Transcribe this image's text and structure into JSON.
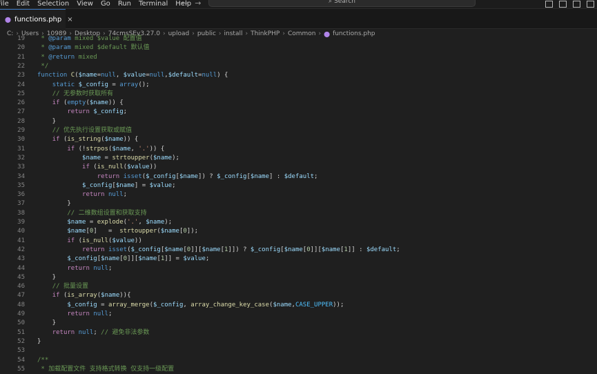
{
  "menu": [
    "File",
    "Edit",
    "Selection",
    "View",
    "Go",
    "Run",
    "Terminal",
    "Help"
  ],
  "search_placeholder": "Search",
  "tab": {
    "label": "functions.php",
    "close": "×"
  },
  "breadcrumb": [
    "C:",
    "Users",
    "10989",
    "Desktop",
    "74cmsSEv3.27.0",
    "upload",
    "public",
    "install",
    "ThinkPHP",
    "Common",
    "functions.php"
  ],
  "colors": {
    "keyword": "#569cd6",
    "control": "#c586c0",
    "function": "#dcdcaa",
    "variable": "#9cdcfe",
    "string": "#ce9178",
    "comment": "#6a9955"
  },
  "code_lines": [
    {
      "n": "19",
      "t": [
        [
          "cmt",
          " * "
        ],
        [
          "doc",
          "@param"
        ],
        [
          "cmt",
          " mixed $value 配置值"
        ]
      ]
    },
    {
      "n": "20",
      "t": [
        [
          "cmt",
          " * "
        ],
        [
          "doc",
          "@param"
        ],
        [
          "cmt",
          " mixed $default 默认值"
        ]
      ]
    },
    {
      "n": "21",
      "t": [
        [
          "cmt",
          " * "
        ],
        [
          "doc",
          "@return"
        ],
        [
          "cmt",
          " mixed"
        ]
      ]
    },
    {
      "n": "22",
      "t": [
        [
          "cmt",
          " */"
        ]
      ]
    },
    {
      "n": "23",
      "t": [
        [
          "kw",
          "function"
        ],
        [
          "pl",
          " "
        ],
        [
          "fn",
          "C"
        ],
        [
          "pl",
          "("
        ],
        [
          "var",
          "$name"
        ],
        [
          "pl",
          "="
        ],
        [
          "kw",
          "null"
        ],
        [
          "pl",
          ", "
        ],
        [
          "var",
          "$value"
        ],
        [
          "pl",
          "="
        ],
        [
          "kw",
          "null"
        ],
        [
          "pl",
          ","
        ],
        [
          "var",
          "$default"
        ],
        [
          "pl",
          "="
        ],
        [
          "kw",
          "null"
        ],
        [
          "pl",
          ") {"
        ]
      ]
    },
    {
      "n": "24",
      "t": [
        [
          "pl",
          "    "
        ],
        [
          "kw",
          "static"
        ],
        [
          "pl",
          " "
        ],
        [
          "var",
          "$_config"
        ],
        [
          "pl",
          " = "
        ],
        [
          "kw",
          "array"
        ],
        [
          "pl",
          "();"
        ]
      ]
    },
    {
      "n": "25",
      "t": [
        [
          "pl",
          "    "
        ],
        [
          "cmt",
          "// 无参数时获取所有"
        ]
      ]
    },
    {
      "n": "26",
      "t": [
        [
          "pl",
          "    "
        ],
        [
          "ctl",
          "if"
        ],
        [
          "pl",
          " ("
        ],
        [
          "kw",
          "empty"
        ],
        [
          "pl",
          "("
        ],
        [
          "var",
          "$name"
        ],
        [
          "pl",
          ")) {"
        ]
      ]
    },
    {
      "n": "27",
      "t": [
        [
          "pl",
          "        "
        ],
        [
          "ctl",
          "return"
        ],
        [
          "pl",
          " "
        ],
        [
          "var",
          "$_config"
        ],
        [
          "pl",
          ";"
        ]
      ]
    },
    {
      "n": "28",
      "t": [
        [
          "pl",
          "    }"
        ]
      ]
    },
    {
      "n": "29",
      "t": [
        [
          "pl",
          "    "
        ],
        [
          "cmt",
          "// 优先执行设置获取或赋值"
        ]
      ]
    },
    {
      "n": "30",
      "t": [
        [
          "pl",
          "    "
        ],
        [
          "ctl",
          "if"
        ],
        [
          "pl",
          " ("
        ],
        [
          "fn",
          "is_string"
        ],
        [
          "pl",
          "("
        ],
        [
          "var",
          "$name"
        ],
        [
          "pl",
          ")) {"
        ]
      ]
    },
    {
      "n": "31",
      "t": [
        [
          "pl",
          "        "
        ],
        [
          "ctl",
          "if"
        ],
        [
          "pl",
          " (!"
        ],
        [
          "fn",
          "strpos"
        ],
        [
          "pl",
          "("
        ],
        [
          "var",
          "$name"
        ],
        [
          "pl",
          ", "
        ],
        [
          "str",
          "'.'"
        ],
        [
          "pl",
          ")) {"
        ]
      ]
    },
    {
      "n": "32",
      "t": [
        [
          "pl",
          "            "
        ],
        [
          "var",
          "$name"
        ],
        [
          "pl",
          " = "
        ],
        [
          "fn",
          "strtoupper"
        ],
        [
          "pl",
          "("
        ],
        [
          "var",
          "$name"
        ],
        [
          "pl",
          ");"
        ]
      ]
    },
    {
      "n": "33",
      "t": [
        [
          "pl",
          "            "
        ],
        [
          "ctl",
          "if"
        ],
        [
          "pl",
          " ("
        ],
        [
          "fn",
          "is_null"
        ],
        [
          "pl",
          "("
        ],
        [
          "var",
          "$value"
        ],
        [
          "pl",
          "))"
        ]
      ]
    },
    {
      "n": "34",
      "t": [
        [
          "pl",
          "                "
        ],
        [
          "ctl",
          "return"
        ],
        [
          "pl",
          " "
        ],
        [
          "kw",
          "isset"
        ],
        [
          "pl",
          "("
        ],
        [
          "var",
          "$_config"
        ],
        [
          "pl",
          "["
        ],
        [
          "var",
          "$name"
        ],
        [
          "pl",
          "]) ? "
        ],
        [
          "var",
          "$_config"
        ],
        [
          "pl",
          "["
        ],
        [
          "var",
          "$name"
        ],
        [
          "pl",
          "] : "
        ],
        [
          "var",
          "$default"
        ],
        [
          "pl",
          ";"
        ]
      ]
    },
    {
      "n": "35",
      "t": [
        [
          "pl",
          "            "
        ],
        [
          "var",
          "$_config"
        ],
        [
          "pl",
          "["
        ],
        [
          "var",
          "$name"
        ],
        [
          "pl",
          "] = "
        ],
        [
          "var",
          "$value"
        ],
        [
          "pl",
          ";"
        ]
      ]
    },
    {
      "n": "36",
      "t": [
        [
          "pl",
          "            "
        ],
        [
          "ctl",
          "return"
        ],
        [
          "pl",
          " "
        ],
        [
          "kw",
          "null"
        ],
        [
          "pl",
          ";"
        ]
      ]
    },
    {
      "n": "37",
      "t": [
        [
          "pl",
          "        }"
        ]
      ]
    },
    {
      "n": "38",
      "t": [
        [
          "pl",
          "        "
        ],
        [
          "cmt",
          "// 二维数组设置和获取支持"
        ]
      ]
    },
    {
      "n": "39",
      "t": [
        [
          "pl",
          "        "
        ],
        [
          "var",
          "$name"
        ],
        [
          "pl",
          " = "
        ],
        [
          "fn",
          "explode"
        ],
        [
          "pl",
          "("
        ],
        [
          "str",
          "'.'"
        ],
        [
          "pl",
          ", "
        ],
        [
          "var",
          "$name"
        ],
        [
          "pl",
          ");"
        ]
      ]
    },
    {
      "n": "40",
      "t": [
        [
          "pl",
          "        "
        ],
        [
          "var",
          "$name"
        ],
        [
          "pl",
          "["
        ],
        [
          "num",
          "0"
        ],
        [
          "pl",
          "]   =  "
        ],
        [
          "fn",
          "strtoupper"
        ],
        [
          "pl",
          "("
        ],
        [
          "var",
          "$name"
        ],
        [
          "pl",
          "["
        ],
        [
          "num",
          "0"
        ],
        [
          "pl",
          "]);"
        ]
      ]
    },
    {
      "n": "41",
      "t": [
        [
          "pl",
          "        "
        ],
        [
          "ctl",
          "if"
        ],
        [
          "pl",
          " ("
        ],
        [
          "fn",
          "is_null"
        ],
        [
          "pl",
          "("
        ],
        [
          "var",
          "$value"
        ],
        [
          "pl",
          "))"
        ]
      ]
    },
    {
      "n": "42",
      "t": [
        [
          "pl",
          "            "
        ],
        [
          "ctl",
          "return"
        ],
        [
          "pl",
          " "
        ],
        [
          "kw",
          "isset"
        ],
        [
          "pl",
          "("
        ],
        [
          "var",
          "$_config"
        ],
        [
          "pl",
          "["
        ],
        [
          "var",
          "$name"
        ],
        [
          "pl",
          "["
        ],
        [
          "num",
          "0"
        ],
        [
          "pl",
          "]]["
        ],
        [
          "var",
          "$name"
        ],
        [
          "pl",
          "["
        ],
        [
          "num",
          "1"
        ],
        [
          "pl",
          "]]) ? "
        ],
        [
          "var",
          "$_config"
        ],
        [
          "pl",
          "["
        ],
        [
          "var",
          "$name"
        ],
        [
          "pl",
          "["
        ],
        [
          "num",
          "0"
        ],
        [
          "pl",
          "]]["
        ],
        [
          "var",
          "$name"
        ],
        [
          "pl",
          "["
        ],
        [
          "num",
          "1"
        ],
        [
          "pl",
          "]] : "
        ],
        [
          "var",
          "$default"
        ],
        [
          "pl",
          ";"
        ]
      ]
    },
    {
      "n": "43",
      "t": [
        [
          "pl",
          "        "
        ],
        [
          "var",
          "$_config"
        ],
        [
          "pl",
          "["
        ],
        [
          "var",
          "$name"
        ],
        [
          "pl",
          "["
        ],
        [
          "num",
          "0"
        ],
        [
          "pl",
          "]]["
        ],
        [
          "var",
          "$name"
        ],
        [
          "pl",
          "["
        ],
        [
          "num",
          "1"
        ],
        [
          "pl",
          "]] = "
        ],
        [
          "var",
          "$value"
        ],
        [
          "pl",
          ";"
        ]
      ]
    },
    {
      "n": "44",
      "t": [
        [
          "pl",
          "        "
        ],
        [
          "ctl",
          "return"
        ],
        [
          "pl",
          " "
        ],
        [
          "kw",
          "null"
        ],
        [
          "pl",
          ";"
        ]
      ]
    },
    {
      "n": "45",
      "t": [
        [
          "pl",
          "    }"
        ]
      ]
    },
    {
      "n": "46",
      "t": [
        [
          "pl",
          "    "
        ],
        [
          "cmt",
          "// 批量设置"
        ]
      ]
    },
    {
      "n": "47",
      "t": [
        [
          "pl",
          "    "
        ],
        [
          "ctl",
          "if"
        ],
        [
          "pl",
          " ("
        ],
        [
          "fn",
          "is_array"
        ],
        [
          "pl",
          "("
        ],
        [
          "var",
          "$name"
        ],
        [
          "pl",
          ")){"
        ]
      ]
    },
    {
      "n": "48",
      "t": [
        [
          "pl",
          "        "
        ],
        [
          "var",
          "$_config"
        ],
        [
          "pl",
          " = "
        ],
        [
          "fn",
          "array_merge"
        ],
        [
          "pl",
          "("
        ],
        [
          "var",
          "$_config"
        ],
        [
          "pl",
          ", "
        ],
        [
          "fn",
          "array_change_key_case"
        ],
        [
          "pl",
          "("
        ],
        [
          "var",
          "$name"
        ],
        [
          "pl",
          ","
        ],
        [
          "const",
          "CASE_UPPER"
        ],
        [
          "pl",
          "));"
        ]
      ]
    },
    {
      "n": "49",
      "t": [
        [
          "pl",
          "        "
        ],
        [
          "ctl",
          "return"
        ],
        [
          "pl",
          " "
        ],
        [
          "kw",
          "null"
        ],
        [
          "pl",
          ";"
        ]
      ]
    },
    {
      "n": "50",
      "t": [
        [
          "pl",
          "    }"
        ]
      ]
    },
    {
      "n": "51",
      "t": [
        [
          "pl",
          "    "
        ],
        [
          "ctl",
          "return"
        ],
        [
          "pl",
          " "
        ],
        [
          "kw",
          "null"
        ],
        [
          "pl",
          "; "
        ],
        [
          "cmt",
          "// 避免非法参数"
        ]
      ]
    },
    {
      "n": "52",
      "t": [
        [
          "pl",
          "}"
        ]
      ]
    },
    {
      "n": "53",
      "t": []
    },
    {
      "n": "54",
      "t": [
        [
          "cmt",
          "/**"
        ]
      ]
    },
    {
      "n": "55",
      "t": [
        [
          "cmt",
          " * 加载配置文件 支持格式转换 仅支持一级配置"
        ]
      ]
    }
  ]
}
